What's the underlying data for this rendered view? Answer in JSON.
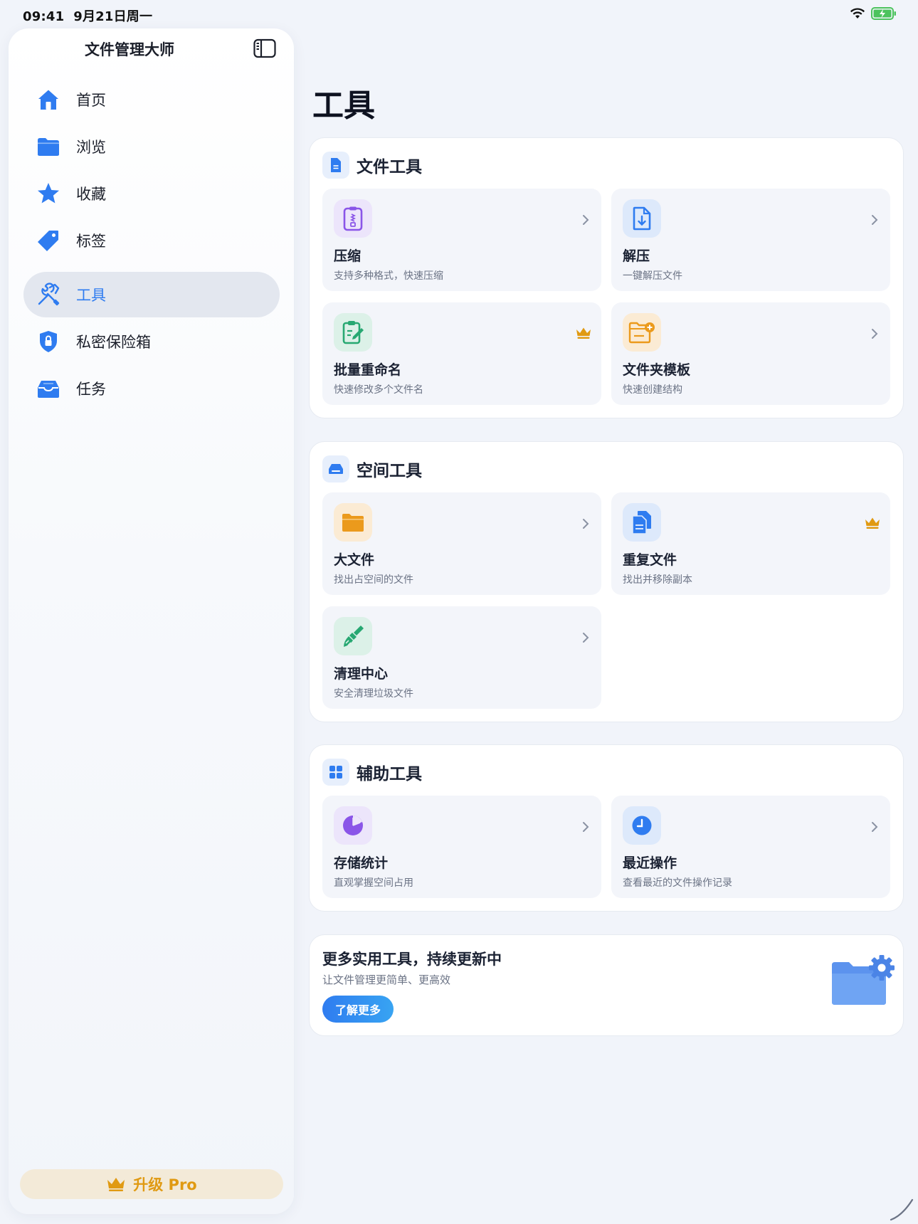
{
  "status": {
    "time": "09:41",
    "date": "9月21日周一"
  },
  "sidebar": {
    "app_title": "文件管理大师",
    "items": [
      {
        "label": "首页",
        "icon": "house-icon"
      },
      {
        "label": "浏览",
        "icon": "folder-icon"
      },
      {
        "label": "收藏",
        "icon": "star-icon"
      },
      {
        "label": "标签",
        "icon": "tag-icon"
      },
      {
        "label": "工具",
        "icon": "wrench-screwdriver-icon",
        "active": true
      },
      {
        "label": "私密保险箱",
        "icon": "lock-shield-icon"
      },
      {
        "label": "任务",
        "icon": "tray-icon"
      }
    ],
    "upgrade_label": "升级 Pro"
  },
  "main": {
    "title": "工具",
    "sections": [
      {
        "title": "文件工具",
        "cards": [
          {
            "title": "压缩",
            "desc": "支持多种格式，快速压缩",
            "pro": false
          },
          {
            "title": "解压",
            "desc": "一键解压文件",
            "pro": false
          },
          {
            "title": "批量重命名",
            "desc": "快速修改多个文件名",
            "pro": true
          },
          {
            "title": "文件夹模板",
            "desc": "快速创建结构",
            "pro": false
          }
        ]
      },
      {
        "title": "空间工具",
        "cards": [
          {
            "title": "大文件",
            "desc": "找出占空间的文件",
            "pro": false
          },
          {
            "title": "重复文件",
            "desc": "找出并移除副本",
            "pro": true
          },
          {
            "title": "清理中心",
            "desc": "安全清理垃圾文件",
            "pro": false
          }
        ]
      },
      {
        "title": "辅助工具",
        "cards": [
          {
            "title": "存储统计",
            "desc": "直观掌握空间占用",
            "pro": false
          },
          {
            "title": "最近操作",
            "desc": "查看最近的文件操作记录",
            "pro": false
          }
        ]
      }
    ],
    "promo": {
      "title": "更多实用工具，持续更新中",
      "subtitle": "让文件管理更简单、更高效",
      "button": "了解更多"
    }
  },
  "colors": {
    "accent": "#2f7cf0",
    "pro_gold": "#e09a12",
    "background": "#f1f4fa"
  }
}
